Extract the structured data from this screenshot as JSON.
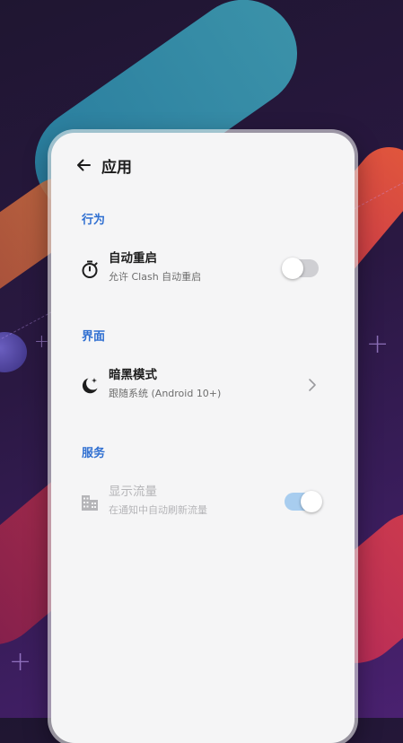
{
  "app_bar": {
    "title": "应用"
  },
  "sections": [
    {
      "header": "行为",
      "items": [
        {
          "title": "自动重启",
          "subtitle": "允许 Clash 自动重启",
          "icon": "timer-icon",
          "control": "switch",
          "state": "off",
          "enabled": true
        }
      ]
    },
    {
      "header": "界面",
      "items": [
        {
          "title": "暗黑模式",
          "subtitle": "跟随系统 (Android 10+)",
          "icon": "dark-mode-icon",
          "control": "chevron",
          "enabled": true
        }
      ]
    },
    {
      "header": "服务",
      "items": [
        {
          "title": "显示流量",
          "subtitle": "在通知中自动刷新流量",
          "icon": "building-icon",
          "control": "switch",
          "state": "on",
          "enabled": false
        }
      ]
    }
  ],
  "colors": {
    "accent": "#2f6fd1",
    "card_bg": "#f5f5f6",
    "switch_on": "#a8cdef",
    "switch_off": "#cfcfd3"
  }
}
